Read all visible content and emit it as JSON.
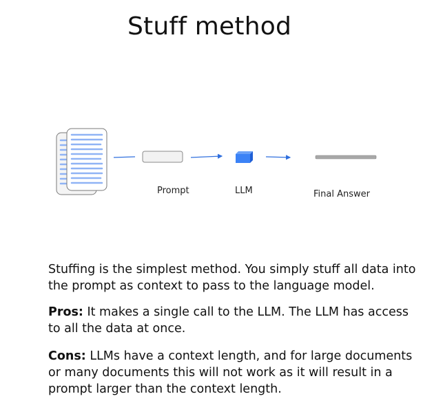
{
  "title": "Stuff method",
  "diagram": {
    "captions": {
      "prompt": "Prompt",
      "llm": "LLM",
      "final_answer": "Final Answer"
    },
    "colors": {
      "arrow": "#2f6fde",
      "doc_lines": "#8fb3f5",
      "llm_cube": "#3b82f6",
      "answer_bar": "#a8a8a8"
    },
    "icons": [
      "document-stack-icon",
      "prompt-box-icon",
      "llm-cube-icon",
      "final-answer-bar-icon"
    ]
  },
  "paragraphs": {
    "intro": "Stuffing is the simplest method. You simply stuff all data into the prompt as context to pass to the language model.",
    "pros_label": "Pros:",
    "pros_text": " It makes a single call to the LLM. The LLM has access to all the data at once.",
    "cons_label": "Cons:",
    "cons_text": " LLMs have a context length, and for large documents or many documents this will not work as it will result in a prompt larger than the context length."
  }
}
